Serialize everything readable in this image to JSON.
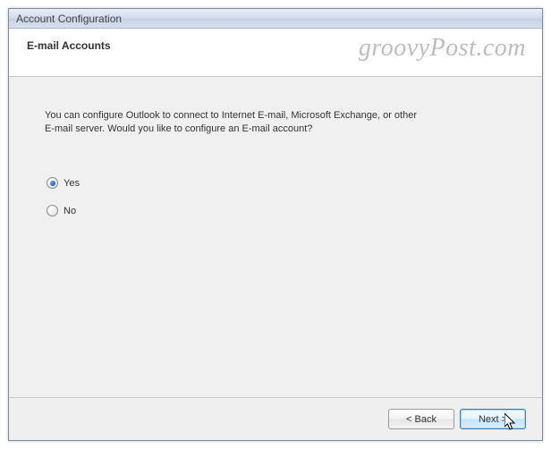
{
  "window": {
    "title": "Account Configuration"
  },
  "header": {
    "heading": "E-mail Accounts"
  },
  "watermark": "groovyPost.com",
  "content": {
    "prompt": "You can configure Outlook to connect to Internet E-mail, Microsoft Exchange, or other E-mail server. Would you like to configure an E-mail account?",
    "options": {
      "yes": "Yes",
      "no": "No",
      "selected": "yes"
    }
  },
  "footer": {
    "back": "< Back",
    "next": "Next >"
  }
}
